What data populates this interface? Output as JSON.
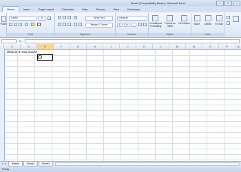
{
  "window": {
    "title": "Book2 [Compatibility Mode] - Microsoft Excel",
    "controls": [
      "–",
      "□",
      "×"
    ]
  },
  "ribbon_tabs": [
    "Home",
    "Insert",
    "Page Layout",
    "Formulas",
    "Data",
    "Review",
    "View",
    "Developer"
  ],
  "ribbon": {
    "clipboard": {
      "label": "",
      "paste": "Paste"
    },
    "font": {
      "label": "Font",
      "font_name": "Calibri",
      "font_size": "11"
    },
    "alignment": {
      "label": "Alignment",
      "wrap": "Wrap Text",
      "merge": "Merge & Center"
    },
    "number": {
      "label": "Number",
      "format": "General",
      "currency": "$",
      "percent": "%",
      "comma": ","
    },
    "styles": {
      "label": "Styles",
      "conditional": "Conditional Formatting",
      "format_table": "Format as Table",
      "cell_styles": "Cell Styles"
    },
    "cells": {
      "label": "Cells",
      "insert": "Insert",
      "delete": "Delete",
      "format": "Format"
    }
  },
  "formula_bar": {
    "name_box": "",
    "fx": "fx",
    "value": ""
  },
  "columns": [
    "C",
    "D",
    "E",
    "F",
    "G",
    "H",
    "I",
    "J",
    "K",
    "L",
    "M",
    "N",
    "O",
    "P",
    "Q"
  ],
  "selected_column": "E",
  "cells": {
    "C2": "What is it How much?"
  },
  "sheets": [
    "Sheet1",
    "Sheet2",
    "Sheet3"
  ],
  "active_sheet": "Sheet1",
  "status": "Ready"
}
